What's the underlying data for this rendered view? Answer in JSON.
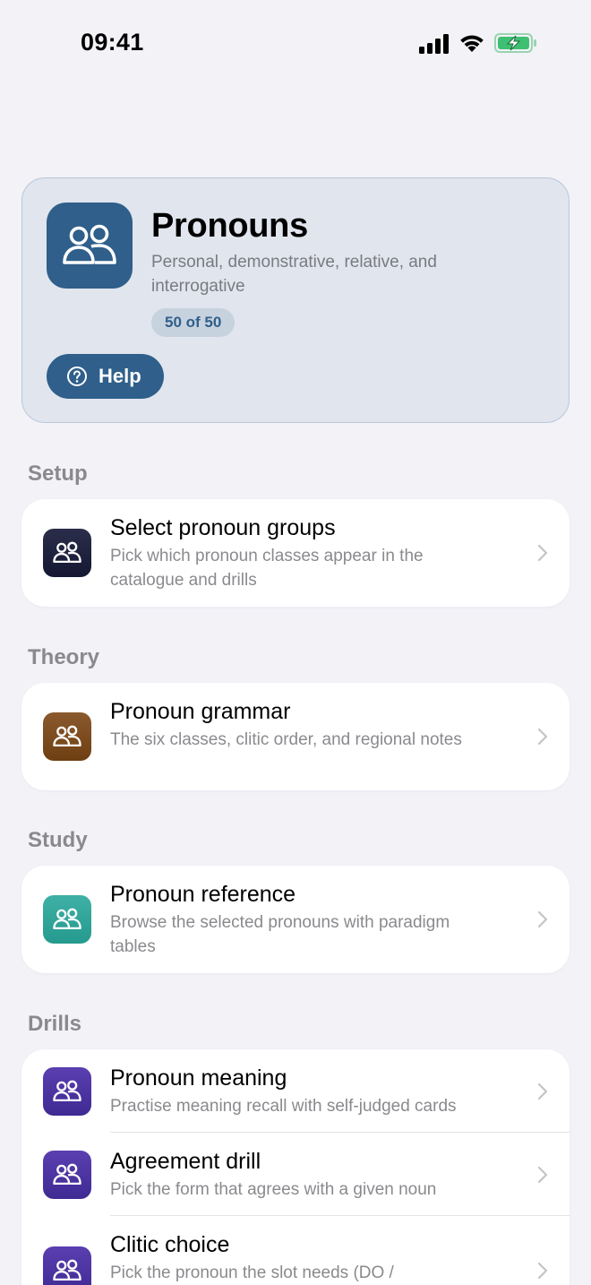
{
  "status": {
    "time": "09:41"
  },
  "header": {
    "title": "Pronouns",
    "subtitle": "Personal, demonstrative, relative, and interrogative",
    "badge": "50 of 50",
    "help_label": "Help"
  },
  "sections": {
    "setup": {
      "label": "Setup",
      "items": [
        {
          "title": "Select pronoun groups",
          "desc": "Pick which pronoun classes appear in the catalogue and drills"
        }
      ]
    },
    "theory": {
      "label": "Theory",
      "items": [
        {
          "title": "Pronoun grammar",
          "desc": "The six classes, clitic order, and regional notes"
        }
      ]
    },
    "study": {
      "label": "Study",
      "items": [
        {
          "title": "Pronoun reference",
          "desc": "Browse the selected pronouns with paradigm tables"
        }
      ]
    },
    "drills": {
      "label": "Drills",
      "items": [
        {
          "title": "Pronoun meaning",
          "desc": "Practise meaning recall with self-judged cards"
        },
        {
          "title": "Agreement drill",
          "desc": "Pick the form that agrees with a given noun"
        },
        {
          "title": "Clitic choice",
          "desc": "Pick the pronoun the slot needs (DO /"
        }
      ]
    }
  },
  "colors": {
    "accent": "#2f5f8a",
    "background": "#f2f2f7",
    "icon_navy": "#1e2240",
    "icon_brown": "#7a4c20",
    "icon_teal": "#31a79b",
    "icon_purple": "#4a34a3"
  },
  "icons": {
    "group": "people-icon",
    "help": "question-circle-icon",
    "chevron": "chevron-right-icon"
  }
}
